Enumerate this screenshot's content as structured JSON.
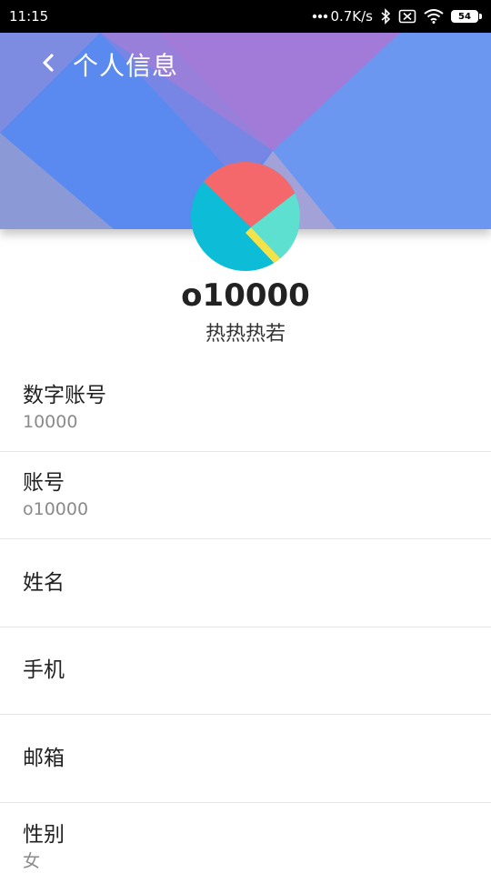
{
  "status_bar": {
    "time": "11:15",
    "network_speed": "0.7K/s",
    "battery_level": "54",
    "icons": [
      "more-dots-icon",
      "bluetooth-icon",
      "sim-disabled-icon",
      "wifi-icon",
      "battery-icon"
    ]
  },
  "header": {
    "title": "个人信息",
    "back_icon": "chevron-left-icon"
  },
  "profile": {
    "username": "o10000",
    "nickname": "热热热若"
  },
  "info_rows": [
    {
      "label": "数字账号",
      "value": "10000"
    },
    {
      "label": "账号",
      "value": "o10000"
    },
    {
      "label": "姓名",
      "value": ""
    },
    {
      "label": "手机",
      "value": ""
    },
    {
      "label": "邮箱",
      "value": ""
    },
    {
      "label": "性别",
      "value": "女"
    }
  ],
  "colors": {
    "banner_blue": "#6a8ff0",
    "banner_purple": "#a07ad8",
    "avatar_red": "#f4676a",
    "avatar_cyan": "#0dbcd6",
    "avatar_teal": "#5de0d0",
    "avatar_yellow": "#f3e24a"
  }
}
